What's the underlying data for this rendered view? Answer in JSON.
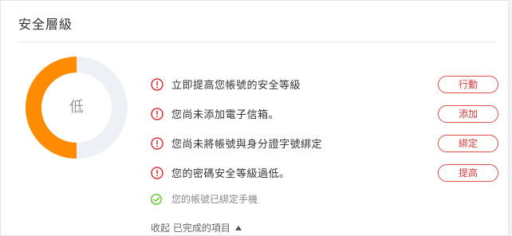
{
  "panel": {
    "title": "安全層級"
  },
  "security_level": {
    "label": "低",
    "progress": 0.5,
    "progress_color": "#ff8c00",
    "track_color": "#edf1f5"
  },
  "warnings": [
    {
      "text": "立即提高您帳號的安全等級",
      "action": "行動",
      "icon": "warning-circle-icon"
    },
    {
      "text": "您尚未添加電子信箱。",
      "action": "添加",
      "icon": "warning-circle-icon"
    },
    {
      "text": "您尚未將帳號與身分證字號綁定",
      "action": "綁定",
      "icon": "warning-circle-icon"
    },
    {
      "text": "您的密碼安全等級過低。",
      "action": "提高",
      "icon": "warning-circle-icon"
    }
  ],
  "completed": [
    {
      "text": "您的帳號已綁定手機",
      "icon": "check-circle-icon"
    }
  ],
  "collapse": {
    "label": "收起 已完成的項目",
    "icon": "caret-up-icon"
  },
  "colors": {
    "warning": "#d9363e",
    "success": "#52c41a",
    "button_border": "#e24a4a"
  }
}
